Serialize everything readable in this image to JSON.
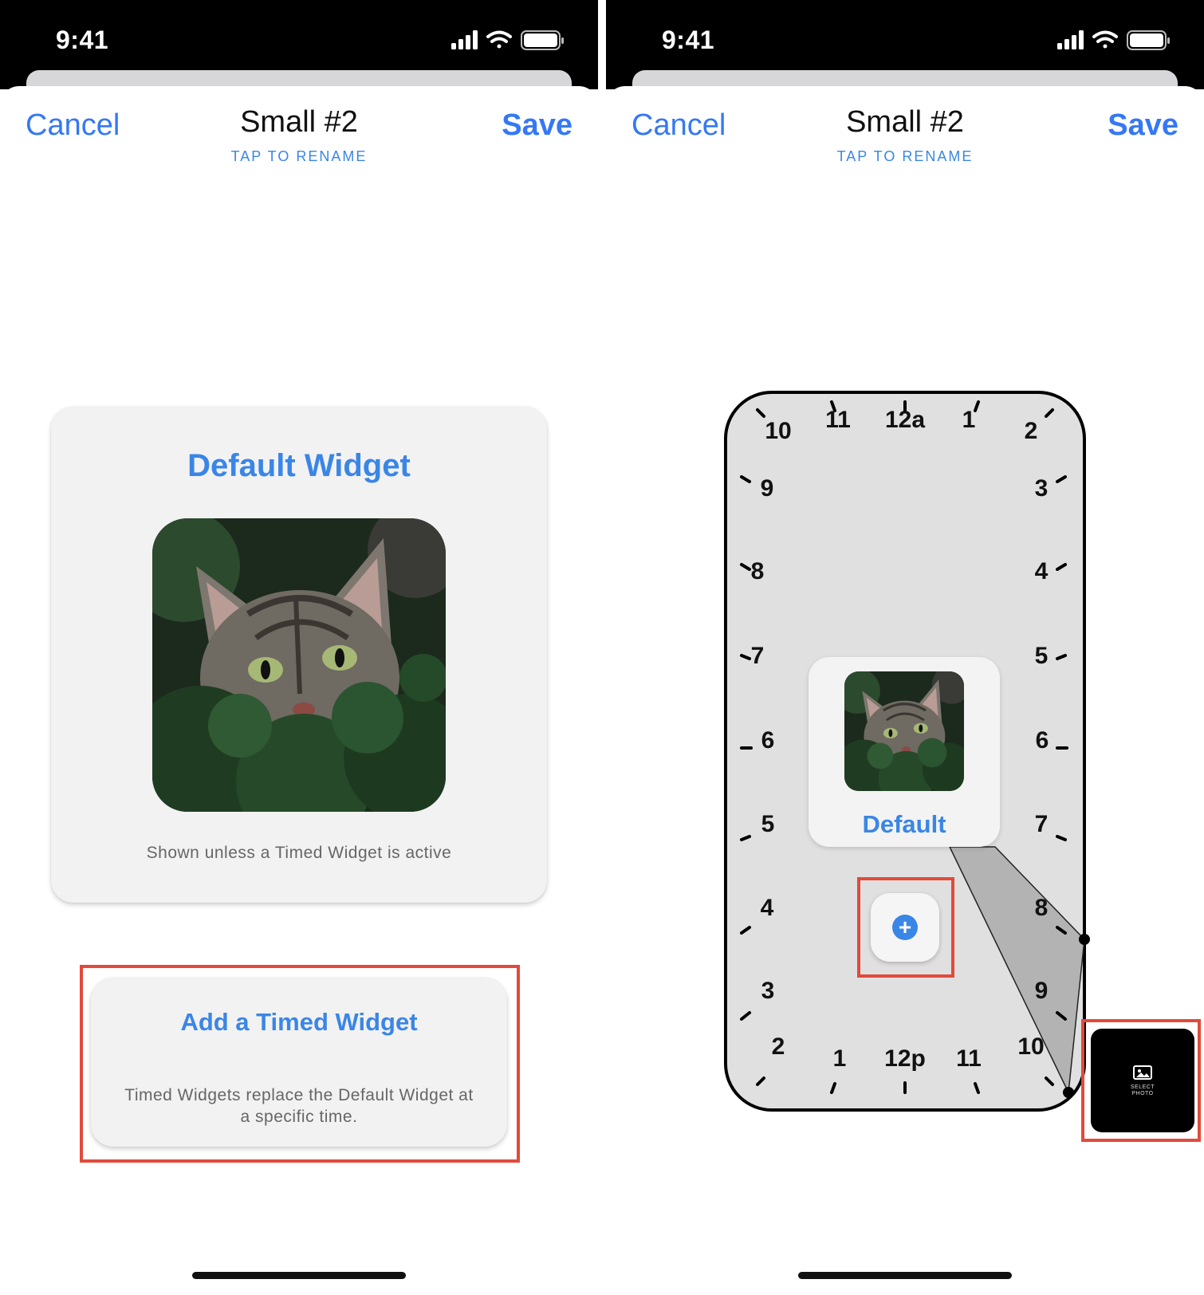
{
  "left_screen": {
    "status_bar": {
      "time": "9:41"
    },
    "nav": {
      "cancel_label": "Cancel",
      "title": "Small #2",
      "subtitle": "TAP TO RENAME",
      "save_label": "Save"
    },
    "default_widget": {
      "title": "Default Widget",
      "caption": "Shown unless a Timed Widget is active"
    },
    "timed_widget": {
      "title": "Add a Timed Widget",
      "description": "Timed Widgets replace the Default Widget at a specific time."
    }
  },
  "right_screen": {
    "status_bar": {
      "time": "9:41"
    },
    "nav": {
      "cancel_label": "Cancel",
      "title": "Small #2",
      "subtitle": "TAP TO RENAME",
      "save_label": "Save"
    },
    "clock": {
      "hour_labels": [
        "12a",
        "1",
        "2",
        "3",
        "4",
        "5",
        "6",
        "7",
        "8",
        "9",
        "10",
        "11",
        "12p",
        "1",
        "2",
        "3",
        "4",
        "5",
        "6",
        "7",
        "8",
        "9",
        "10",
        "11"
      ],
      "selected_range": {
        "start": "8",
        "end": "10"
      }
    },
    "default_tile": {
      "label": "Default"
    },
    "select_photo": {
      "label_line1": "SELECT",
      "label_line2": "PHOTO"
    }
  },
  "colors": {
    "accent_blue": "#3a86e6",
    "highlight_red": "#e24a3b",
    "clock_fill": "#e0e0e0",
    "range_fill": "#b3b3b3"
  }
}
